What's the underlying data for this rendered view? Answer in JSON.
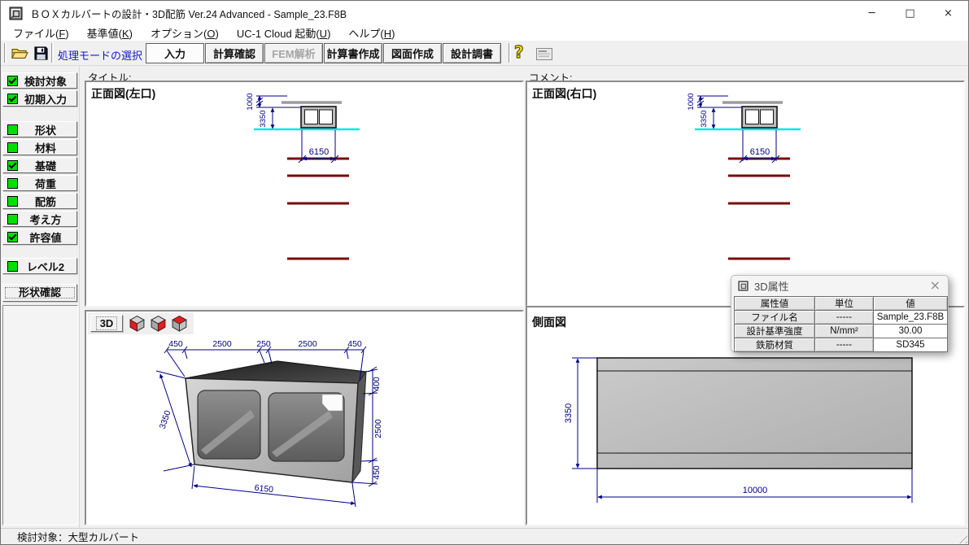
{
  "window": {
    "title": "ＢＯＸカルバートの設計・3D配筋 Ver.24 Advanced - Sample_23.F8B",
    "minimize": "─",
    "maximize": "□",
    "close": "×"
  },
  "menu": {
    "items": [
      {
        "pre": "ファイル(",
        "key": "F",
        "suf": ")"
      },
      {
        "pre": "基準値(",
        "key": "K",
        "suf": ")"
      },
      {
        "pre": "オプション(",
        "key": "O",
        "suf": ")"
      },
      {
        "pre": "UC-1 Cloud 起動(",
        "key": "U",
        "suf": ")"
      },
      {
        "pre": "ヘルプ(",
        "key": "H",
        "suf": ")"
      }
    ]
  },
  "toolbar": {
    "mode_label": "処理モードの選択",
    "modes": [
      {
        "label": "入力",
        "state": "active"
      },
      {
        "label": "計算確認",
        "state": "normal"
      },
      {
        "label": "FEM解析",
        "state": "disabled"
      },
      {
        "label": "計算書作成",
        "state": "normal"
      },
      {
        "label": "図面作成",
        "state": "normal"
      },
      {
        "label": "設計調書",
        "state": "normal"
      }
    ],
    "help_icon": "?"
  },
  "sidebar": {
    "items": [
      {
        "label": "検討対象",
        "checked": true
      },
      {
        "label": "初期入力",
        "checked": true
      },
      {
        "label": "形状",
        "checked": false
      },
      {
        "label": "材料",
        "checked": false
      },
      {
        "label": "基礎",
        "checked": true
      },
      {
        "label": "荷重",
        "checked": false
      },
      {
        "label": "配筋",
        "checked": false
      },
      {
        "label": "考え方",
        "checked": false
      },
      {
        "label": "許容値",
        "checked": true
      },
      {
        "label": "レベル2",
        "checked": false
      }
    ],
    "confirm_label": "形状確認"
  },
  "content": {
    "title_label": "タイトル:",
    "comment_label": "コメント:",
    "front_left": {
      "title": "正面図(左口)",
      "dims": {
        "top": "1000",
        "height": "3350",
        "width": "6150"
      }
    },
    "front_right": {
      "title": "正面図(右口)",
      "dims": {
        "top": "1000",
        "height": "3350",
        "width": "6150"
      }
    },
    "view3d": {
      "button_label": "3D",
      "top_dims": [
        "450",
        "2500",
        "250",
        "2500",
        "450"
      ],
      "left_dim": "3350",
      "right_dims": [
        "400",
        "2500",
        "450"
      ],
      "bottom_dim": "6150"
    },
    "side_view": {
      "title": "側面図",
      "height_dim": "3350",
      "width_dim": "10000"
    }
  },
  "popup": {
    "title": "3D属性",
    "close": "×",
    "table": {
      "headers": [
        "属性値",
        "単位",
        "値"
      ],
      "rows": [
        [
          "ファイル名",
          "-----",
          "Sample_23.F8B"
        ],
        [
          "設計基準強度",
          "N/mm²",
          "30.00"
        ],
        [
          "鉄筋材質",
          "-----",
          "SD345"
        ]
      ]
    }
  },
  "statusbar": {
    "text": "検討対象：大型カルバート"
  }
}
